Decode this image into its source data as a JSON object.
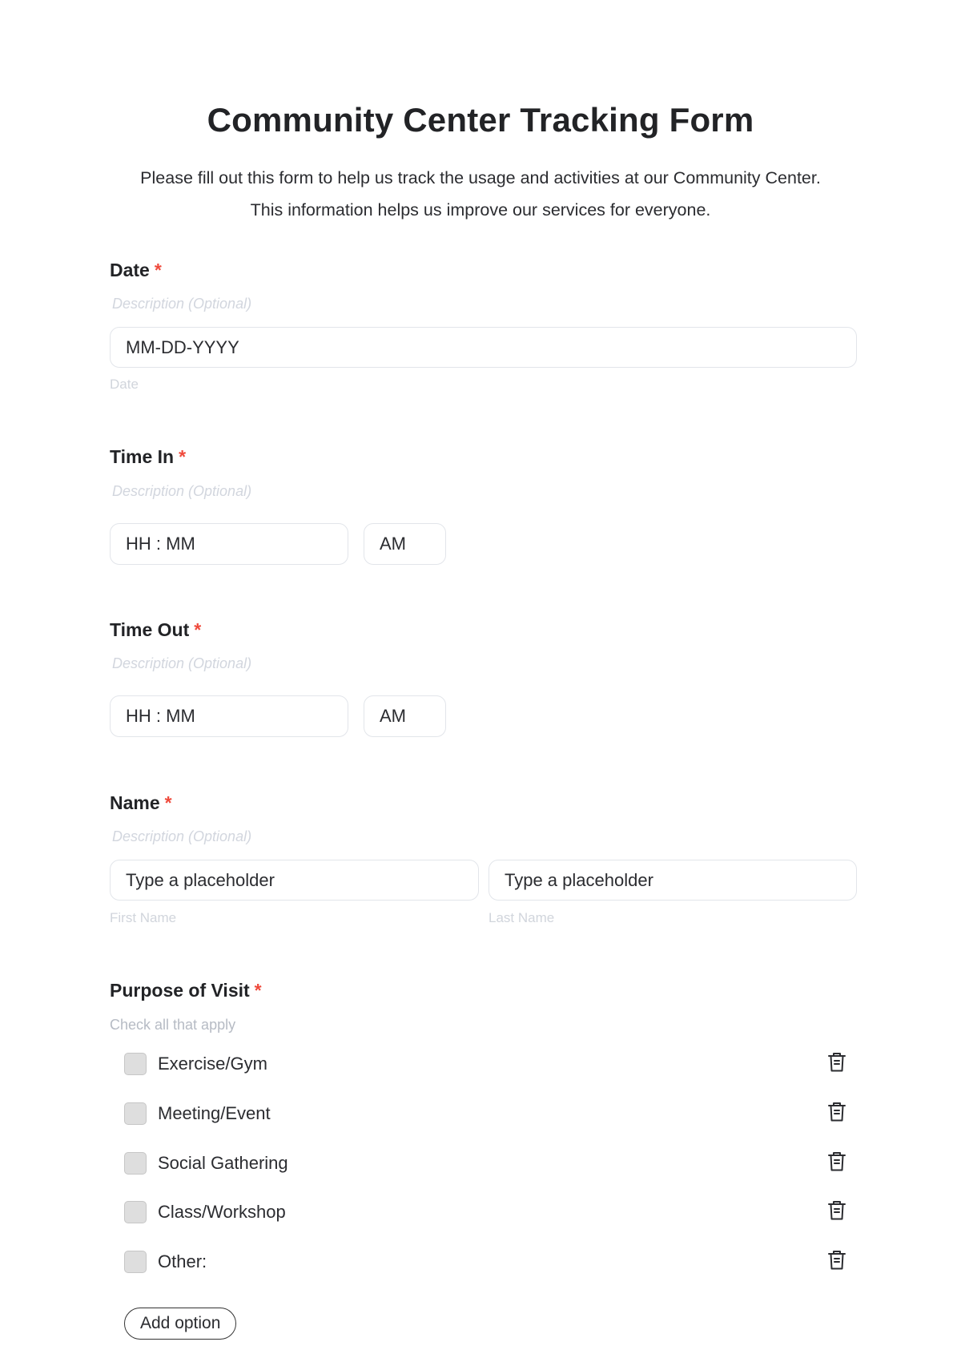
{
  "form": {
    "title": "Community Center Tracking Form",
    "intro": "Please fill out this form to help us track the usage and activities at our Community Center. This information helps us improve our services for everyone."
  },
  "fields": {
    "date": {
      "label": "Date",
      "required_mark": "*",
      "description": "Description (Optional)",
      "placeholder": "MM-DD-YYYY",
      "helper": "Date"
    },
    "time_in": {
      "label": "Time In",
      "required_mark": "*",
      "description": "Description (Optional)",
      "time_placeholder": "HH : MM",
      "period": "AM"
    },
    "time_out": {
      "label": "Time Out",
      "required_mark": "*",
      "description": "Description (Optional)",
      "time_placeholder": "HH : MM",
      "period": "AM"
    },
    "name": {
      "label": "Name",
      "required_mark": "*",
      "description": "Description (Optional)",
      "first_placeholder": "Type a placeholder",
      "last_placeholder": "Type a placeholder",
      "first_helper": "First Name",
      "last_helper": "Last Name"
    },
    "purpose": {
      "label": "Purpose of Visit",
      "required_mark": "*",
      "hint": "Check all that apply",
      "options": [
        {
          "label": "Exercise/Gym",
          "checked": false,
          "icon": "trash-icon"
        },
        {
          "label": "Meeting/Event",
          "checked": false,
          "icon": "trash-icon"
        },
        {
          "label": "Social Gathering",
          "checked": false,
          "icon": "trash-icon"
        },
        {
          "label": "Class/Workshop",
          "checked": false,
          "icon": "trash-icon"
        },
        {
          "label": "Other:",
          "checked": false,
          "icon": "trash-icon"
        }
      ],
      "add_option_label": "Add option"
    }
  },
  "colors": {
    "required": "#ef4a3c",
    "text": "#222326",
    "muted": "#d2d6de",
    "border": "#e2e5ea",
    "checkbox_fill": "#dedede"
  }
}
